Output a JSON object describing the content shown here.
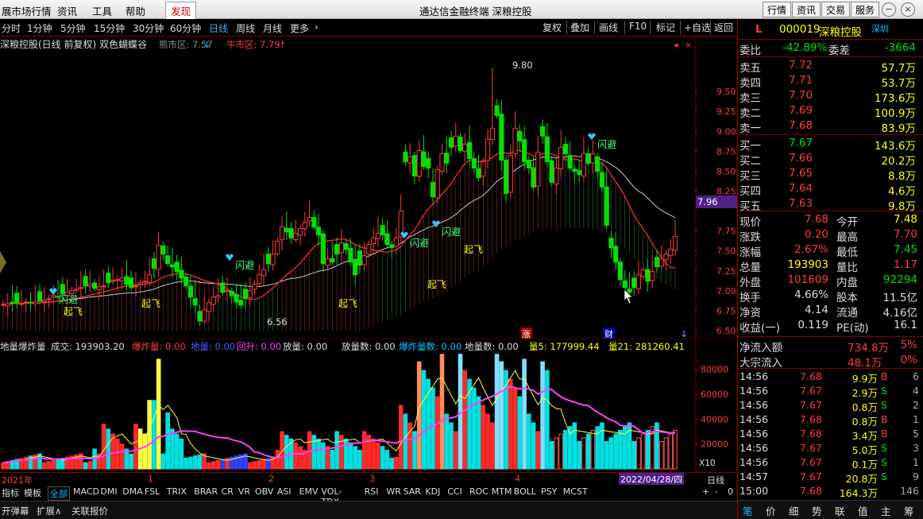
{
  "menubar": {
    "items": [
      "展市场行情",
      "资讯",
      "工具",
      "帮助"
    ],
    "discover": "发现",
    "title": "通达信金融终端  深粮控股",
    "right_buttons": [
      "行情",
      "资讯",
      "交易",
      "服务"
    ]
  },
  "toolbar": {
    "periods": [
      "分时",
      "1分钟",
      "5分钟",
      "15分钟",
      "30分钟",
      "60分钟",
      "日线",
      "周线",
      "月线",
      "更多"
    ],
    "active_period": "日线",
    "tools": [
      "复权",
      "叠加",
      "画线",
      "F10",
      "标记",
      "+自选",
      "返回"
    ]
  },
  "chart": {
    "info_title": "深粮控股(日线 前复权) 双色蝴蝶谷",
    "bear_label": "熊市区: 7.57",
    "bull_label": "牛市区: 7.79",
    "price_ticks": [
      "9.50",
      "9.25",
      "9.00",
      "8.75",
      "8.50",
      "8.25",
      "7.75",
      "7.50",
      "7.25",
      "7.00",
      "6.75",
      "6.50"
    ],
    "current_price_tag": "7.96",
    "high_label": "9.80",
    "low_label": "6.56",
    "signals": {
      "fly": "起飞",
      "dodge": "闪避"
    },
    "markers": {
      "zhang": "涨",
      "cai": "财"
    }
  },
  "chart_data": {
    "type": "candlestick",
    "title": "深粮控股(日线 前复权)",
    "ylim": [
      6.45,
      10.05
    ],
    "high": 9.8,
    "low": 6.56,
    "last_close": 7.68,
    "volume_ylim": [
      0,
      100000
    ],
    "volume_ticks": [
      "80000",
      "60000",
      "40000",
      "20000"
    ],
    "volume_unit": "X10",
    "ma5": 177999.44,
    "ma21": 281260.41,
    "date_labels": [
      "2021年",
      "1",
      "2",
      "3",
      "4"
    ],
    "cursor_date": "2022/04/28/四"
  },
  "sub": {
    "line": [
      "地量爆炸量",
      "成交: 193903.20",
      "爆炸量: 0.00",
      "地量: 0.00",
      "回升: 0.00",
      "放量: 0.00",
      "放量数: 0.00",
      "爆炸量数: 0.00",
      "地量数: 0.00",
      "量5: 177999.44",
      "量21: 281260.41"
    ],
    "vol_ticks": [
      "80000",
      "60000",
      "40000",
      "20000"
    ],
    "unit": "X10"
  },
  "bottom": {
    "year": "2021年",
    "months": [
      "1",
      "2",
      "3",
      "4"
    ],
    "date": "2022/04/28/四",
    "period": "日线",
    "ind_label": "指标",
    "template": "模板",
    "all": "全部",
    "indicators": [
      "MACD",
      "DMI",
      "DMA",
      "FSL",
      "TRIX",
      "BRAR",
      "CR",
      "VR",
      "OBV",
      "ASI",
      "EMV",
      "VOL-TDX",
      "RSI",
      "WR",
      "SAR",
      "KDJ",
      "CCI",
      "ROC",
      "MTM",
      "BOLL",
      "PSY",
      "MCST"
    ],
    "pm": [
      "+",
      "-",
      "0"
    ],
    "tabs": [
      "开弹幕",
      "扩展∧",
      "关联报价"
    ]
  },
  "quote": {
    "flag": "L",
    "code": "000019",
    "name": "深粮控股",
    "region": "深圳",
    "weibi_label": "委比",
    "weibi": "-42.89%",
    "weicha_label": "委差",
    "weicha": "-3664",
    "asks": [
      {
        "label": "卖五",
        "price": "7.72",
        "vol": "57.7万"
      },
      {
        "label": "卖四",
        "price": "7.71",
        "vol": "53.7万"
      },
      {
        "label": "卖三",
        "price": "7.70",
        "vol": "173.6万"
      },
      {
        "label": "卖二",
        "price": "7.69",
        "vol": "100.9万"
      },
      {
        "label": "卖一",
        "price": "7.68",
        "vol": "83.9万"
      }
    ],
    "bids": [
      {
        "label": "买一",
        "price": "7.67",
        "vol": "143.6万"
      },
      {
        "label": "买二",
        "price": "7.66",
        "vol": "20.2万"
      },
      {
        "label": "买三",
        "price": "7.65",
        "vol": "8.8万"
      },
      {
        "label": "买四",
        "price": "7.64",
        "vol": "4.6万"
      },
      {
        "label": "买五",
        "price": "7.63",
        "vol": "9.8万"
      }
    ],
    "stats": [
      {
        "l1": "现价",
        "v1": "7.68",
        "l2": "今开",
        "v2": "7.48"
      },
      {
        "l1": "涨跌",
        "v1": "0.20",
        "l2": "最高",
        "v2": "7.70"
      },
      {
        "l1": "涨幅",
        "v1": "2.67%",
        "l2": "最低",
        "v2": "7.45"
      },
      {
        "l1": "总量",
        "v1": "193903",
        "l2": "量比",
        "v2": "1.17"
      },
      {
        "l1": "外盘",
        "v1": "101609",
        "l2": "内盘",
        "v2": "92294"
      },
      {
        "l1": "换手",
        "v1": "4.66%",
        "l2": "股本",
        "v2": "11.5亿"
      },
      {
        "l1": "净资",
        "v1": "4.14",
        "l2": "流通",
        "v2": "4.16亿"
      },
      {
        "l1": "收益(一)",
        "v1": "0.119",
        "l2": "PE(动)",
        "v2": "16.1"
      }
    ],
    "flows": [
      {
        "l": "净流入额",
        "v": "734.8万",
        "p": "5%"
      },
      {
        "l": "大宗流入",
        "v": "48.1万",
        "p": "0%"
      }
    ],
    "ticks": [
      {
        "t": "14:56",
        "p": "7.68",
        "v": "9.9万",
        "s": "B",
        "n": "6"
      },
      {
        "t": "14:56",
        "p": "7.67",
        "v": "2.9万",
        "s": "S",
        "n": "4"
      },
      {
        "t": "14:56",
        "p": "7.67",
        "v": "0.8万",
        "s": "S",
        "n": "2"
      },
      {
        "t": "14:56",
        "p": "7.68",
        "v": "0.8万",
        "s": "B",
        "n": "1"
      },
      {
        "t": "14:56",
        "p": "7.68",
        "v": "3.4万",
        "s": "B",
        "n": "5"
      },
      {
        "t": "14:56",
        "p": "7.67",
        "v": "5.0万",
        "s": "S",
        "n": "3"
      },
      {
        "t": "14:56",
        "p": "7.67",
        "v": "0.1万",
        "s": "S",
        "n": "1"
      },
      {
        "t": "14:57",
        "p": "7.67",
        "v": "20.8万",
        "s": "S",
        "n": "9"
      },
      {
        "t": "15:00",
        "p": "7.68",
        "v": "164.3万",
        "s": "",
        "n": "146"
      }
    ],
    "tabs": [
      "笔",
      "价",
      "细",
      "势",
      "联",
      "值",
      "主",
      "筹"
    ]
  },
  "colors": {
    "up": "#ff3c3c",
    "down": "#00e000",
    "ma_red": "#ff2a2a",
    "ma_white": "#c8c8c8"
  }
}
